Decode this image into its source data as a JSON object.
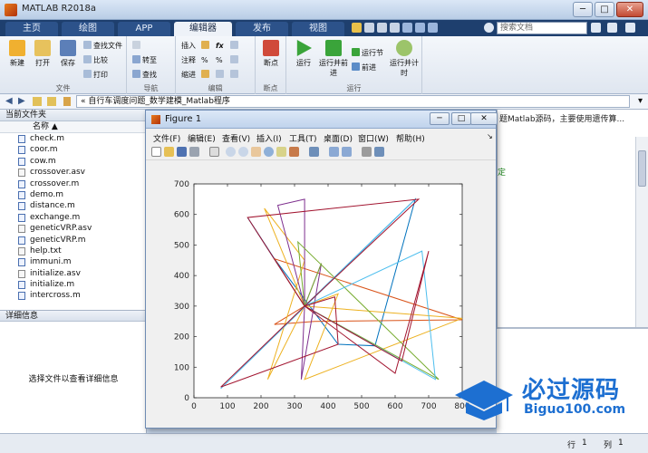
{
  "window": {
    "title": "MATLAB R2018a"
  },
  "tabs": [
    "主页",
    "绘图",
    "APP",
    "编辑器",
    "发布",
    "视图"
  ],
  "active_tab": "编辑器",
  "search": {
    "placeholder": "搜索文档"
  },
  "ribbon": {
    "file_group": {
      "label": "文件",
      "new": "新建",
      "open": "打开",
      "save": "保存",
      "find_files": "查找文件",
      "compare": "比较",
      "print": "打印"
    },
    "nav_group": {
      "label": "导航",
      "goto": "转至",
      "find": "查找"
    },
    "edit_group": {
      "label": "编辑",
      "insert": "插入",
      "comment": "注释",
      "indent": "缩进"
    },
    "breakpoint_group": {
      "label": "断点",
      "breakpoints": "断点"
    },
    "run_group": {
      "label": "运行",
      "run": "运行",
      "run_advance": "运行并前进",
      "run_section": "运行节",
      "advance": "前进",
      "run_time": "运行并计时"
    }
  },
  "address": {
    "path": "« 自行车调度问题_数学建模_Matlab程序"
  },
  "file_panel": {
    "title": "当前文件夹",
    "name_col": "名称 ▲",
    "files": [
      "check.m",
      "coor.m",
      "cow.m",
      "crossover.asv",
      "crossover.m",
      "demo.m",
      "distance.m",
      "exchange.m",
      "geneticVRP.asv",
      "geneticVRP.m",
      "help.txt",
      "immuni.m",
      "initialize.asv",
      "initialize.m",
      "intercross.m"
    ]
  },
  "details": {
    "title": "详细信息",
    "placeholder": "选择文件以查看详细信息"
  },
  "editor": {
    "hint": "题Matlab源码，主要使用遗传算...",
    "green_text": "定"
  },
  "statusbar": {
    "row_label": "行",
    "row_value": "1",
    "col_label": "列",
    "col_value": "1"
  },
  "figure": {
    "title": "Figure 1",
    "menus": [
      "文件(F)",
      "编辑(E)",
      "查看(V)",
      "插入(I)",
      "工具(T)",
      "桌面(D)",
      "窗口(W)",
      "帮助(H)"
    ]
  },
  "watermark": {
    "big": "必过源码",
    "small": "Biguo100.com"
  },
  "chart_data": {
    "type": "line",
    "title": "",
    "xlabel": "",
    "ylabel": "",
    "xlim": [
      0,
      800
    ],
    "ylim": [
      0,
      700
    ],
    "xticks": [
      0,
      100,
      200,
      300,
      400,
      500,
      600,
      700,
      800
    ],
    "yticks": [
      0,
      100,
      200,
      300,
      400,
      500,
      600,
      700
    ],
    "grid": false,
    "series": [
      {
        "color": "#0072bd",
        "points": [
          [
            330,
            300
          ],
          [
            160,
            590
          ],
          [
            240,
            455
          ],
          [
            430,
            175
          ],
          [
            540,
            170
          ],
          [
            660,
            650
          ],
          [
            330,
            300
          ]
        ]
      },
      {
        "color": "#d95319",
        "points": [
          [
            330,
            300
          ],
          [
            240,
            240
          ],
          [
            360,
            250
          ],
          [
            800,
            255
          ],
          [
            240,
            455
          ],
          [
            330,
            300
          ]
        ]
      },
      {
        "color": "#edb120",
        "points": [
          [
            330,
            300
          ],
          [
            210,
            620
          ],
          [
            330,
            450
          ],
          [
            220,
            60
          ],
          [
            330,
            300
          ],
          [
            800,
            260
          ],
          [
            330,
            60
          ],
          [
            430,
            340
          ],
          [
            330,
            300
          ]
        ]
      },
      {
        "color": "#7e2f8e",
        "points": [
          [
            330,
            300
          ],
          [
            250,
            630
          ],
          [
            330,
            650
          ],
          [
            330,
            300
          ],
          [
            380,
            440
          ],
          [
            320,
            60
          ],
          [
            330,
            300
          ]
        ]
      },
      {
        "color": "#77ac30",
        "points": [
          [
            330,
            300
          ],
          [
            380,
            440
          ],
          [
            330,
            300
          ],
          [
            310,
            510
          ],
          [
            730,
            60
          ],
          [
            330,
            300
          ]
        ]
      },
      {
        "color": "#4dbeee",
        "points": [
          [
            330,
            300
          ],
          [
            660,
            650
          ],
          [
            80,
            30
          ],
          [
            330,
            300
          ],
          [
            720,
            60
          ],
          [
            680,
            480
          ],
          [
            330,
            300
          ]
        ]
      },
      {
        "color": "#a2142f",
        "points": [
          [
            330,
            300
          ],
          [
            670,
            650
          ],
          [
            160,
            590
          ],
          [
            330,
            300
          ],
          [
            420,
            330
          ],
          [
            430,
            175
          ],
          [
            80,
            35
          ],
          [
            330,
            300
          ]
        ]
      },
      {
        "color": "#a2142f",
        "points": [
          [
            330,
            300
          ],
          [
            600,
            80
          ],
          [
            700,
            480
          ],
          [
            620,
            120
          ],
          [
            330,
            300
          ]
        ]
      }
    ]
  }
}
